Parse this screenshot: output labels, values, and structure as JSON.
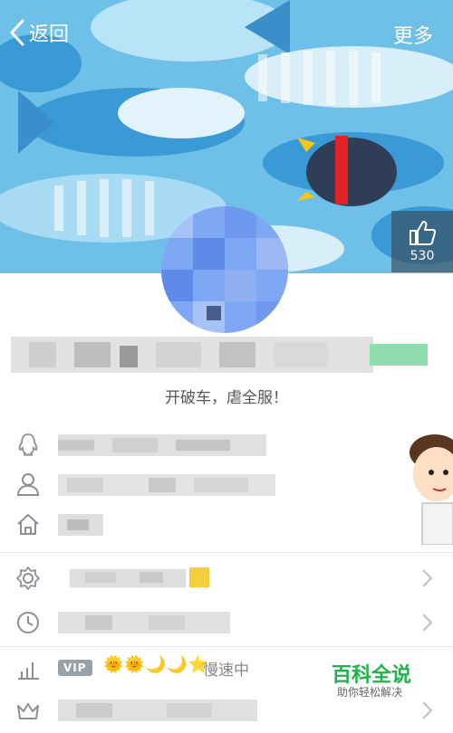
{
  "header": {
    "back_label": "返回",
    "more_label": "更多"
  },
  "likes": {
    "count": "530"
  },
  "profile": {
    "signature": "开破车，虐全服！"
  },
  "vip": {
    "badge": "VIP",
    "icons": "🌞🌞🌙🌙⭐",
    "status": "慢速中"
  },
  "watermark": {
    "title": "百科全说",
    "subtitle": "助你轻松解决"
  },
  "colors": {
    "sky": "#6fc0e8",
    "fish_light": "#a9dcf4",
    "fish_dark": "#3a8ec9",
    "accent_green": "#22b14c"
  }
}
